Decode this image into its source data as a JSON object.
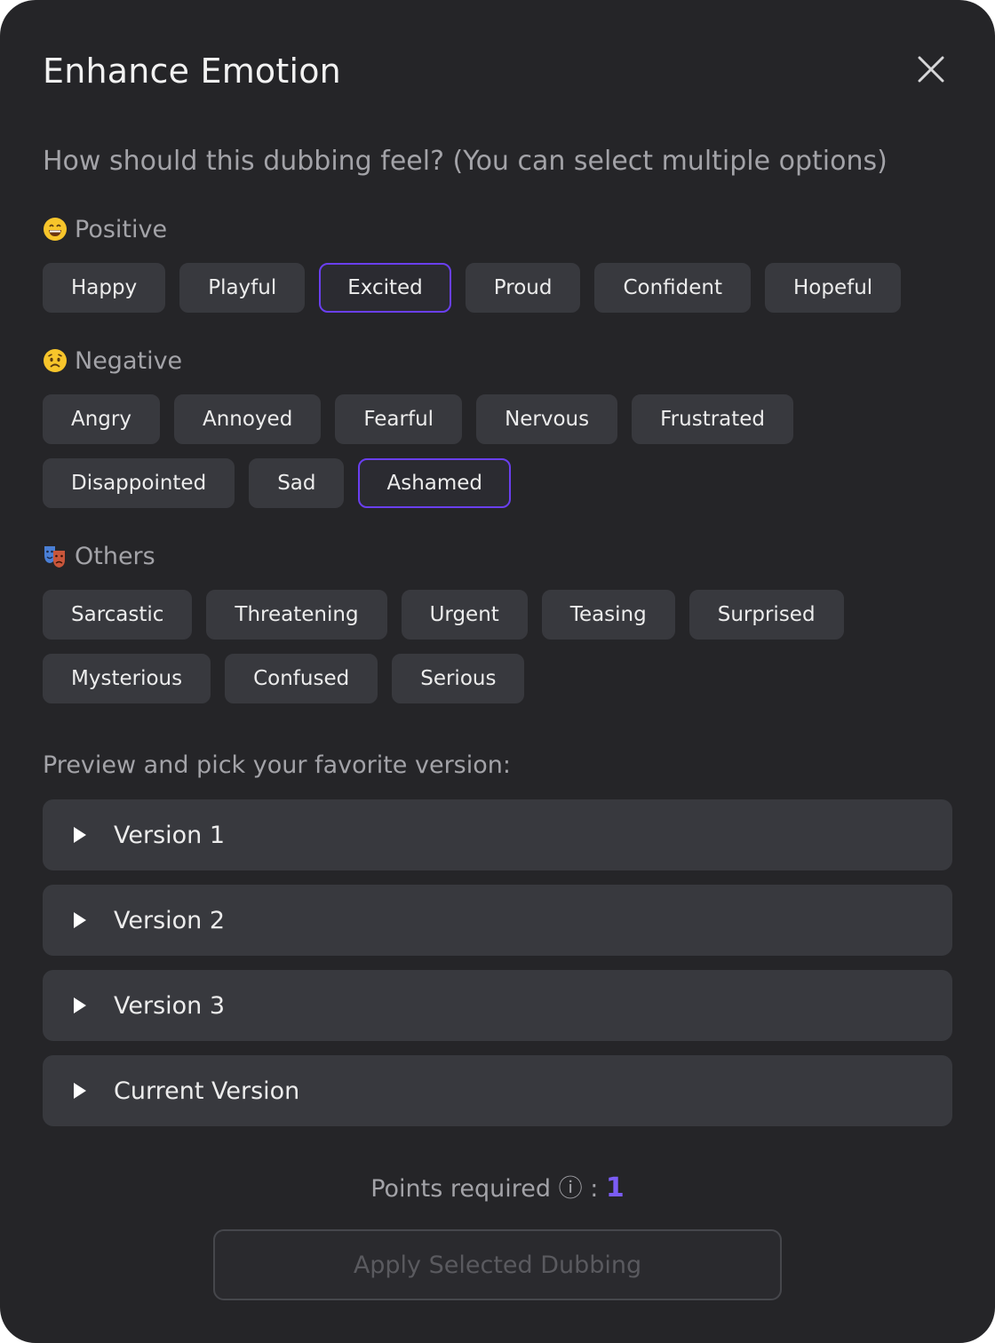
{
  "dialog": {
    "title": "Enhance Emotion",
    "close_icon": "close-icon",
    "question": "How should this dubbing feel? (You can select multiple options)"
  },
  "groups": {
    "positive": {
      "label": "Positive",
      "icon": "grinning-face-emoji",
      "options": [
        {
          "label": "Happy",
          "selected": false
        },
        {
          "label": "Playful",
          "selected": false
        },
        {
          "label": "Excited",
          "selected": true
        },
        {
          "label": "Proud",
          "selected": false
        },
        {
          "label": "Confident",
          "selected": false
        },
        {
          "label": "Hopeful",
          "selected": false
        }
      ]
    },
    "negative": {
      "label": "Negative",
      "icon": "worried-face-emoji",
      "options": [
        {
          "label": "Angry",
          "selected": false
        },
        {
          "label": "Annoyed",
          "selected": false
        },
        {
          "label": "Fearful",
          "selected": false
        },
        {
          "label": "Nervous",
          "selected": false
        },
        {
          "label": "Frustrated",
          "selected": false
        },
        {
          "label": "Disappointed",
          "selected": false
        },
        {
          "label": "Sad",
          "selected": false
        },
        {
          "label": "Ashamed",
          "selected": true
        }
      ]
    },
    "others": {
      "label": "Others",
      "icon": "theater-masks-emoji",
      "options": [
        {
          "label": "Sarcastic",
          "selected": false
        },
        {
          "label": "Threatening",
          "selected": false
        },
        {
          "label": "Urgent",
          "selected": false
        },
        {
          "label": "Teasing",
          "selected": false
        },
        {
          "label": "Surprised",
          "selected": false
        },
        {
          "label": "Mysterious",
          "selected": false
        },
        {
          "label": "Confused",
          "selected": false
        },
        {
          "label": "Serious",
          "selected": false
        }
      ]
    }
  },
  "preview": {
    "label": "Preview and pick your favorite version:",
    "versions": [
      {
        "label": "Version 1",
        "icon": "play-icon"
      },
      {
        "label": "Version 2",
        "icon": "play-icon"
      },
      {
        "label": "Version 3",
        "icon": "play-icon"
      },
      {
        "label": "Current Version",
        "icon": "play-icon"
      }
    ]
  },
  "footer": {
    "points_label": "Points required ⓘ : ",
    "points_value": "1",
    "apply_label": "Apply Selected Dubbing",
    "apply_disabled": true
  },
  "colors": {
    "background": "#252528",
    "chip": "#38393e",
    "accent": "#6a3ff0",
    "points_accent": "#7b5cf5"
  }
}
